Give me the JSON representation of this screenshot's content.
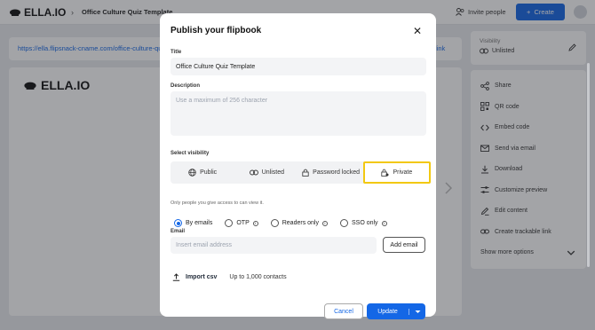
{
  "topbar": {
    "logo": "ELLA.IO",
    "separator": "›",
    "breadcrumb": "Office Culture Quiz Template",
    "invite_label": "Invite people",
    "create_label": "Create"
  },
  "background": {
    "url": "https://ella.flipsnack-cname.com/office-culture-qui",
    "link_text": "link",
    "preview_logo": "ELLA.IO"
  },
  "sidebar": {
    "visibility_label": "Visibility",
    "visibility_value": "Unlisted",
    "items": [
      {
        "label": "Share",
        "icon": "share-icon"
      },
      {
        "label": "QR code",
        "icon": "qr-code-icon"
      },
      {
        "label": "Embed code",
        "icon": "embed-code-icon"
      },
      {
        "label": "Send via email",
        "icon": "mail-icon"
      },
      {
        "label": "Download",
        "icon": "download-icon"
      },
      {
        "label": "Customize preview",
        "icon": "sliders-icon"
      },
      {
        "label": "Edit content",
        "icon": "edit-icon"
      },
      {
        "label": "Create trackable link",
        "icon": "link-icon"
      }
    ],
    "show_more": "Show more options"
  },
  "modal": {
    "title": "Publish your flipbook",
    "title_label": "Title",
    "title_value": "Office Culture Quiz Template",
    "description_label": "Description",
    "description_placeholder": "Use a maximum of 256 character",
    "visibility_label": "Select visibility",
    "visibility_options": [
      {
        "label": "Public",
        "icon": "globe-icon"
      },
      {
        "label": "Unlisted",
        "icon": "link-icon"
      },
      {
        "label": "Password locked",
        "icon": "lock-icon"
      },
      {
        "label": "Private",
        "icon": "private-lock-icon"
      }
    ],
    "selected_visibility": "Private",
    "visibility_help": "Only people you give access to can view it.",
    "access_options": [
      {
        "label": "By emails",
        "selected": true,
        "info": false
      },
      {
        "label": "OTP",
        "selected": false,
        "info": true
      },
      {
        "label": "Readers only",
        "selected": false,
        "info": true
      },
      {
        "label": "SSO only",
        "selected": false,
        "info": true
      }
    ],
    "email_label": "Email",
    "email_placeholder": "Insert email address",
    "add_email_label": "Add email",
    "import_label": "Import csv",
    "import_limit": "Up to 1,000 contacts",
    "cancel_label": "Cancel",
    "update_label": "Update"
  },
  "colors": {
    "accent": "#1467e6",
    "highlight": "#f2c811",
    "overlay": "#23262d"
  }
}
